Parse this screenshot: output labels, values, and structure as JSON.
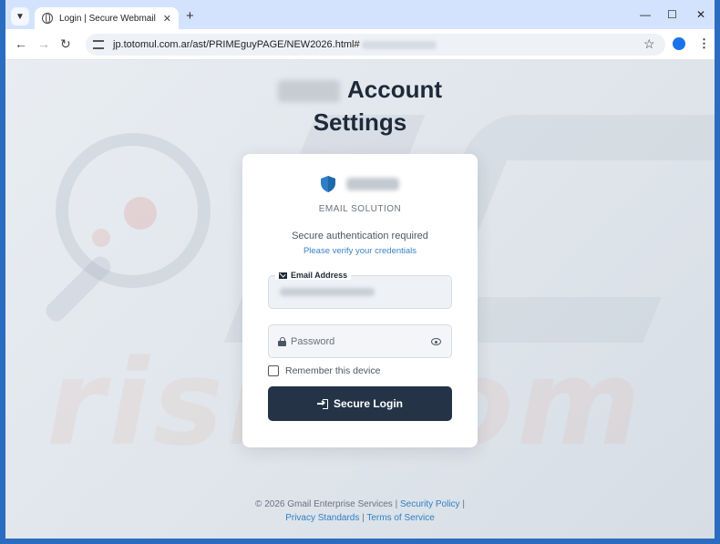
{
  "browser": {
    "tab_title": "Login | Secure Webmail",
    "tab_close": "✕",
    "new_tab": "+",
    "url": "jp.totomul.com.ar/ast/PRIMEguyPAGE/NEW2026.html#",
    "win_min": "—",
    "win_max": "☐",
    "win_close": "✕",
    "back": "←",
    "forward": "→",
    "reload": "↻",
    "star": "☆",
    "menu": "⋮"
  },
  "page": {
    "title_line1": "Account",
    "title_line2": "Settings"
  },
  "card": {
    "brand_subtitle": "EMAIL SOLUTION",
    "auth_text": "Secure authentication required",
    "verify_text": "Please verify your credentials",
    "email_label": "Email Address",
    "password_placeholder": "Password",
    "remember_label": "Remember this device",
    "login_button": "Secure Login"
  },
  "footer": {
    "copyright": "© 2026 Gmail Enterprise Services |",
    "security_policy": "Security Policy",
    "sep1": "|",
    "privacy_standards": "Privacy Standards",
    "sep2": "|",
    "terms": "Terms of Service"
  },
  "watermark": {
    "text": "risk.com"
  },
  "colors": {
    "accent": "#2f7fc4",
    "button": "#253346",
    "shield": "#2f7fc4"
  }
}
